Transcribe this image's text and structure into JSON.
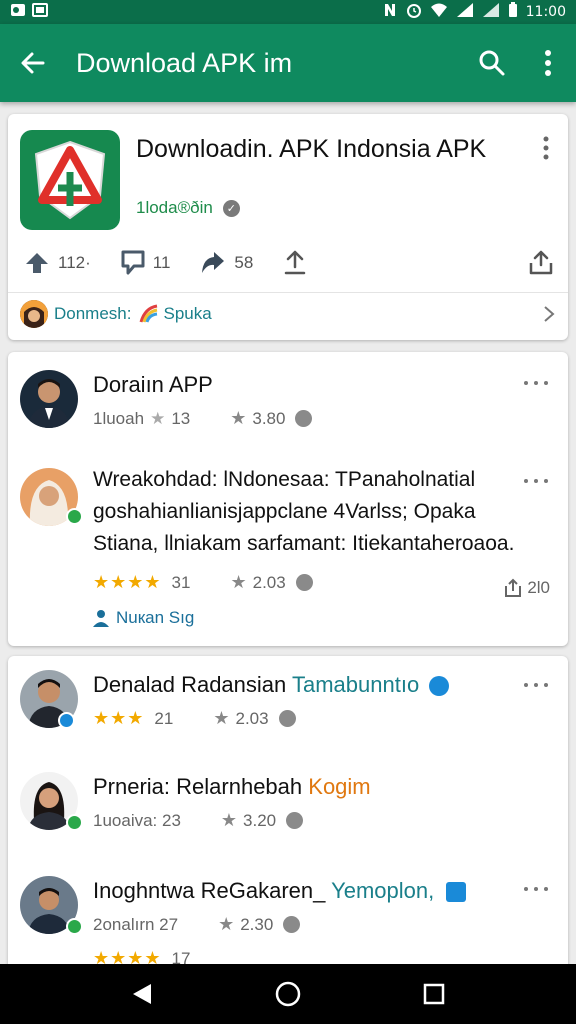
{
  "status_bar": {
    "left_icons": [
      "notification-icon-1",
      "notification-icon-2"
    ],
    "time": "11:00"
  },
  "app_bar": {
    "title": "Download APK im"
  },
  "app_card": {
    "name": "Downloadin. APK Indonsia APK",
    "developer": "1loda®ðin",
    "actions": [
      {
        "icon": "upvote-icon",
        "count": "112·"
      },
      {
        "icon": "comment-icon",
        "count": "11"
      },
      {
        "icon": "share-arrow-icon",
        "count": "58"
      }
    ],
    "dev_row": {
      "label": "Donmesh:",
      "name": "Spuka"
    }
  },
  "posts": [
    {
      "title": "Doraiın APP",
      "meta_left": "1luoah",
      "meta_count": "13",
      "rating": "3.80"
    },
    {
      "body": "Wreakohdad: lNdonesaa: TPanaholnatial goshahianlianisjappclane 4Varlss; Opaka Stiana, llniakam sarfamant: Itiekantaheroaoa.",
      "stars_count": "31",
      "rating": "2.03",
      "shares": "2l0",
      "user_tag": "Nuкan Sıg"
    },
    {
      "title_main": "Denalad Radansian",
      "title_handle": "Tamabunntıo",
      "stars_count": "21",
      "rating": "2.03"
    },
    {
      "title_main": "Prneria: Relarnhebah",
      "title_accent": "Kogim",
      "meta_left": "1uoaiva: 23",
      "rating": "3.20"
    },
    {
      "title_main": "Inoghntwa ReGakaren_",
      "title_handle": "Yemoplon,",
      "meta_left": "2onalırn 27",
      "rating": "2.30",
      "stars_count": "17"
    }
  ],
  "colors": {
    "app_bar": "#0f8a5f",
    "status_bar": "#0b6e4a",
    "star": "#f2a900",
    "accent_link": "#1a7f8a"
  }
}
